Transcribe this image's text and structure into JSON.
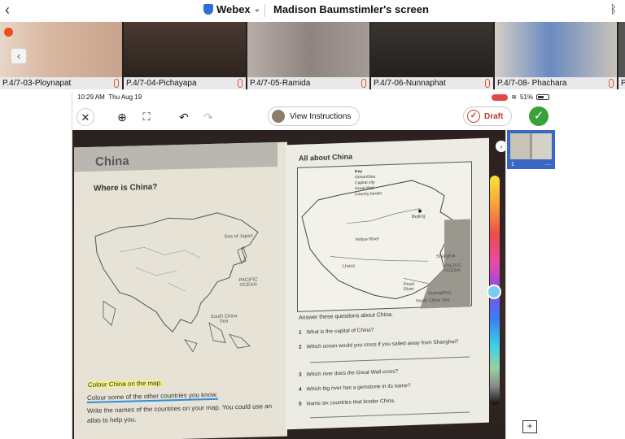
{
  "window": {
    "back_icon": "chevron-left-icon",
    "app_name": "Webex",
    "screen_title": "Madison Baumstimler's screen",
    "bluetooth_icon": "bluetooth-icon"
  },
  "participants": [
    {
      "name": "P.4/7-03-Ploynapat",
      "color": "#d9b7a1"
    },
    {
      "name": "P.4/7-04-Pichayapa",
      "color": "#3b2e26"
    },
    {
      "name": "P.4/7-05-Ramida",
      "color": "#9a8f8a"
    },
    {
      "name": "P.4/7-06-Nunnaphat",
      "color": "#2f2a26"
    },
    {
      "name": "P.4/7-08- Phachara",
      "color": "#c8c3b9"
    },
    {
      "name": "P",
      "color": "#555"
    }
  ],
  "ipad_status": {
    "time": "10:29 AM",
    "date": "Thu Aug 19",
    "battery": "51%"
  },
  "toolbar": {
    "close_icon": "close-icon",
    "zoom_icon": "zoom-in-icon",
    "fullscreen_icon": "expand-icon",
    "undo_icon": "undo-icon",
    "redo_icon": "redo-icon",
    "view_instructions": "View Instructions",
    "draft": "Draft",
    "done_icon": "checkmark-icon"
  },
  "worksheet": {
    "left_title": "China",
    "where_heading": "Where is China?",
    "map_labels": {
      "sea_of_japan": "Sea of Japan",
      "pacific": "PACIFIC OCEAN",
      "south_china_sea": "South China Sea"
    },
    "instructions": [
      "Colour China on the map.",
      "Colour some of the other countries you know.",
      "Write the names of the countries on your map. You could use an",
      "atlas to help you."
    ],
    "right_title": "All about China",
    "key": {
      "title": "Key",
      "items": [
        "Ocean/Sea",
        "Capital city",
        "Great Wall",
        "Country border"
      ]
    },
    "map_places": {
      "beijing": "Beijing",
      "yellow_river": "Yellow River",
      "lhasa": "Lhasa",
      "shanghai": "Shanghai",
      "pacific": "PACIFIC OCEAN",
      "pearl_river": "Pearl River",
      "guangzhou": "Guangzhou",
      "south_china_sea": "South China Sea"
    },
    "answer_heading": "Answer these questions about China.",
    "questions": [
      {
        "num": "1",
        "text": "What is the capital of China?"
      },
      {
        "num": "2",
        "text": "Which ocean would you cross if you sailed away from Shanghai?"
      },
      {
        "num": "3",
        "text": "Which river does the Great Wall cross?"
      },
      {
        "num": "4",
        "text": "Which big river has a gemstone in its name?"
      },
      {
        "num": "5",
        "text": "Name six countries that border China."
      }
    ]
  },
  "thumbnails": {
    "page_number": "1",
    "more_icon": "ellipsis-icon",
    "add_page_icon": "add-page-icon"
  }
}
